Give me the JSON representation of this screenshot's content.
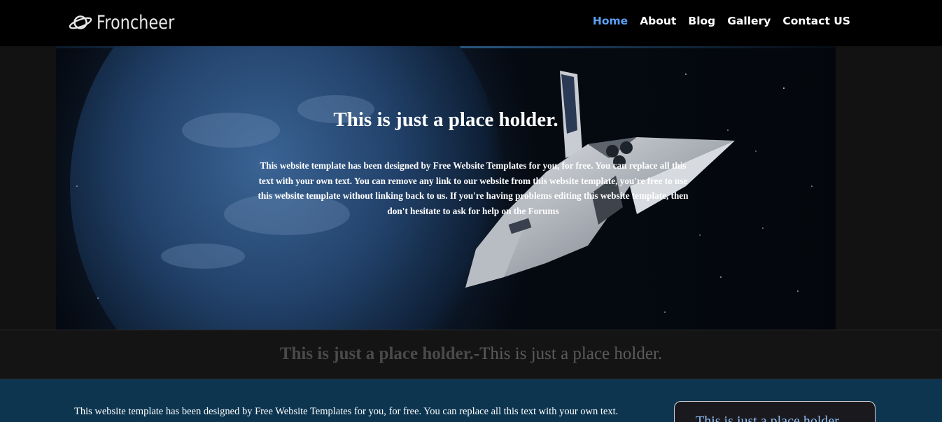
{
  "brand": {
    "name": "Froncheer",
    "icon": "planet-icon"
  },
  "nav": {
    "items": [
      {
        "label": "Home",
        "active": true
      },
      {
        "label": "About",
        "active": false
      },
      {
        "label": "Blog",
        "active": false
      },
      {
        "label": "Gallery",
        "active": false
      },
      {
        "label": "Contact US",
        "active": false
      }
    ]
  },
  "hero": {
    "title": "This is just a place holder.",
    "body": "This website template has been designed by Free Website Templates for you, for free. You can replace all this text with your own text. You can remove any link to our website from this website template, you're free to use this website template without linking back to us. If you're having problems editing this website template, then don't hesitate to ask for help on the Forums"
  },
  "strip": {
    "bold": "This is just a place holder.",
    "separator": "-",
    "normal": "This is just a place holder."
  },
  "content": {
    "intro": "This website template has been designed by Free Website Templates for you, for free. You can replace all this text with your own text."
  },
  "sidebar": {
    "card_title": "This is just a place holder."
  },
  "colors": {
    "accent": "#5aa0f5",
    "header_bg": "#000000",
    "bottom_bg": "#0d3550"
  }
}
